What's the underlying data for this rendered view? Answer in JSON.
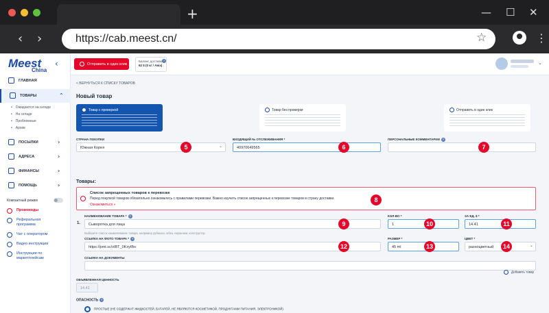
{
  "browser": {
    "url": "https://cab.meest.cn/",
    "icons": {
      "new_tab": "+",
      "back": "‹",
      "forward": "›",
      "star": "☆",
      "menu": "⋮",
      "minimize": "—",
      "maximize": "☐",
      "close": "✕"
    }
  },
  "colors": {
    "brand_red": "#e3072a",
    "brand_blue": "#1455b0",
    "badge_red": "#e3072a"
  },
  "sidebar": {
    "logo": "Meest",
    "logo_sub": "China",
    "items": [
      {
        "label": "Главная",
        "icon": "home-icon"
      },
      {
        "label": "Товары",
        "icon": "box-icon",
        "active": true
      },
      {
        "label": "Посылки",
        "icon": "parcel-icon"
      },
      {
        "label": "Адреса",
        "icon": "address-icon"
      },
      {
        "label": "Финансы",
        "icon": "finance-icon"
      },
      {
        "label": "Помощь",
        "icon": "help-icon"
      }
    ],
    "sub_items": [
      "Ожидаются на складе",
      "На складе",
      "Проблемные",
      "Архив"
    ],
    "compact_mode": "Компактный режим",
    "links": [
      {
        "label": "Промокоды",
        "icon": "promo-icon"
      },
      {
        "label": "Реферальная программа",
        "icon": "referral-icon"
      },
      {
        "label": "Чат с оператором",
        "icon": "chat-icon"
      },
      {
        "label": "Видео инструкции",
        "icon": "video-icon"
      },
      {
        "label": "Инструкции по маркетплейсам",
        "icon": "instructions-icon"
      }
    ]
  },
  "header": {
    "one_click_label": "Отправить в один клик",
    "balance_label": "Баланс доставки",
    "balance_value": "62 $ (0 кг / Авіа)",
    "info": "?"
  },
  "main": {
    "back_link": "< Вернуться к списку товаров",
    "title": "Новый товар",
    "modes": [
      {
        "title": "Товар с проверкой",
        "selected": true
      },
      {
        "title": "Товар без проверки",
        "selected": false
      },
      {
        "title": "Отправить в один клик",
        "selected": false
      }
    ],
    "fields": {
      "country": {
        "label": "Страна покупки",
        "value": "Южная Корея"
      },
      "tracking": {
        "label": "Входящий № отслеживания *",
        "value": "40970649565"
      },
      "comments": {
        "label": "Персональные комментарии",
        "value": ""
      },
      "product_name": {
        "label": "Наименование товара *",
        "value": "Сыворотка для лица",
        "hint": "Выберите список наименование товара, например рубашка, юбка, наушники, конструктор"
      },
      "qty": {
        "label": "Кол-во *",
        "value": "1"
      },
      "unit_price": {
        "label": "За ед. $ *",
        "value": "14.41"
      },
      "photo_link": {
        "label": "Ссылка на фото товара *",
        "value": "https://pmt.sc/vIBT_0KxyIBo"
      },
      "size": {
        "label": "Размер *",
        "value": "45 ml"
      },
      "color": {
        "label": "Цвет *",
        "value": "разноцветный"
      },
      "doc_link": {
        "label": "Ссылка на документы",
        "value": ""
      },
      "declared_value": {
        "label": "Объявленная ценность",
        "value": "14.41"
      }
    },
    "goods_section": "Товары:",
    "alert": {
      "title": "Список запрещенных товаров к перевозке",
      "text": "Перед покупкой товаров обязательно ознакомьтесь с правилами перевозки. Важно изучить список запрещенных к перевозке товаров в страну доставки.",
      "link": "Ознакомиться »"
    },
    "item_number": "1.",
    "add_product": "Добавить товар",
    "danger_label": "Опасность",
    "danger_option": "Простые (не содержат жидкостей, батарей, не являются косметикой, продуктами питания, электроникой)"
  },
  "badges": [
    "5",
    "6",
    "7",
    "8",
    "9",
    "10",
    "11",
    "12",
    "13",
    "14"
  ]
}
